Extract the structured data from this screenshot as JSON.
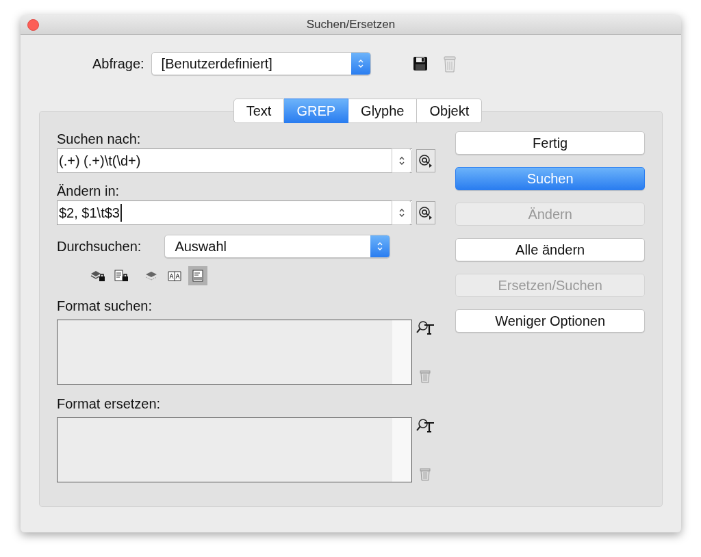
{
  "window": {
    "title": "Suchen/Ersetzen"
  },
  "query": {
    "label": "Abfrage:",
    "value": "[Benutzerdefiniert]"
  },
  "tabs": [
    {
      "label": "Text",
      "selected": false
    },
    {
      "label": "GREP",
      "selected": true
    },
    {
      "label": "Glyphe",
      "selected": false
    },
    {
      "label": "Objekt",
      "selected": false
    }
  ],
  "find": {
    "label": "Suchen nach:",
    "value": "(.+) (.+)\\t(\\d+)"
  },
  "change": {
    "label": "Ändern in:",
    "value": "$2, $1\\t$3"
  },
  "search_in": {
    "label": "Durchsuchen:",
    "value": "Auswahl"
  },
  "scope_toggles": [
    {
      "kind": "layers-lock",
      "selected": false
    },
    {
      "kind": "page-lock",
      "selected": false
    },
    {
      "kind": "layers",
      "selected": false
    },
    {
      "kind": "book",
      "selected": false
    },
    {
      "kind": "note",
      "selected": true
    }
  ],
  "format_find": {
    "label": "Format suchen:"
  },
  "format_replace": {
    "label": "Format ersetzen:"
  },
  "buttons": [
    {
      "label": "Fertig",
      "primary": false,
      "disabled": false
    },
    {
      "label": "Suchen",
      "primary": true,
      "disabled": false
    },
    {
      "label": "Ändern",
      "primary": false,
      "disabled": true
    },
    {
      "label": "Alle ändern",
      "primary": false,
      "disabled": false
    },
    {
      "label": "Ersetzen/Suchen",
      "primary": false,
      "disabled": true
    },
    {
      "label": "Weniger Optionen",
      "primary": false,
      "disabled": false
    }
  ]
}
